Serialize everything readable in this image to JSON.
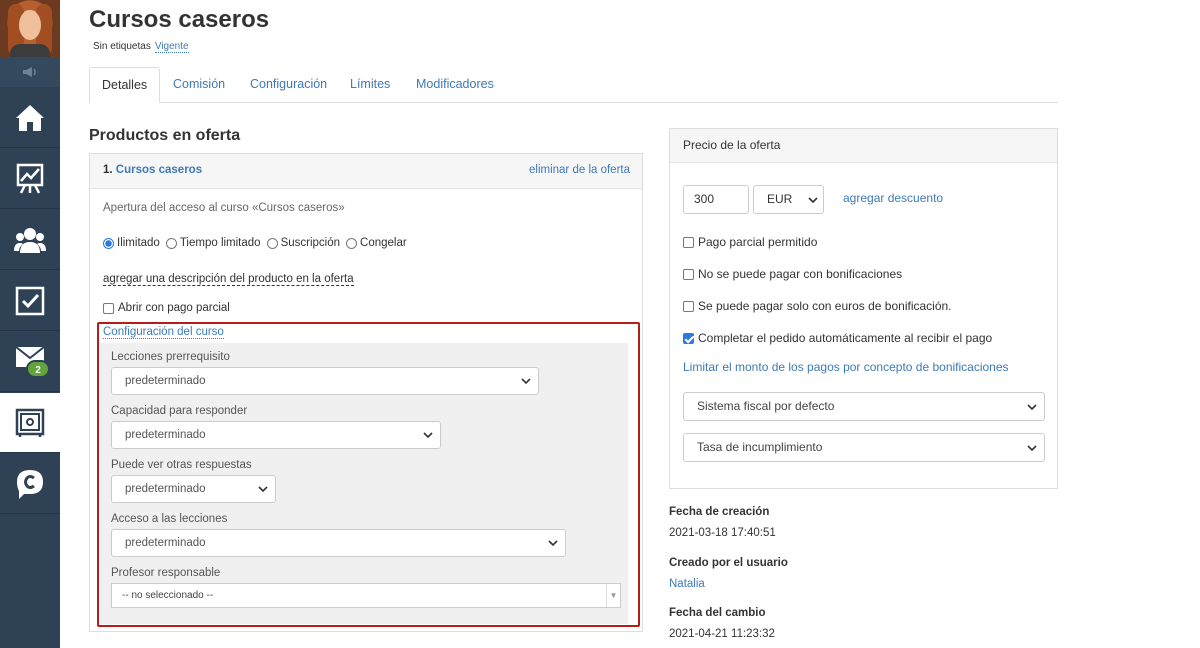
{
  "sidebar": {
    "items": [
      {
        "name": "home-icon"
      },
      {
        "name": "analytics-icon"
      },
      {
        "name": "users-icon"
      },
      {
        "name": "tasks-icon"
      },
      {
        "name": "mail-icon",
        "badge": "2"
      },
      {
        "name": "safe-icon"
      },
      {
        "name": "chat-icon"
      }
    ]
  },
  "header": {
    "title": "Cursos caseros",
    "tags": "Sin etiquetas",
    "status": "Vigente"
  },
  "tabs": [
    "Detalles",
    "Comisión",
    "Configuración",
    "Límites",
    "Modificadores"
  ],
  "products": {
    "heading": "Productos en oferta",
    "offer": {
      "number": "1.",
      "name": "Cursos caseros",
      "delete_label": "eliminar de la oferta",
      "description": "Apertura del acceso al curso «Cursos caseros»",
      "radio_options": [
        "Ilimitado",
        "Tiempo limitado",
        "Suscripción",
        "Congelar"
      ],
      "selected_radio": "Ilimitado",
      "add_description": "agregar una descripción del producto en la oferta",
      "partial_payment_label": "Abrir con pago parcial",
      "course_config_link": "Configuración del curso",
      "config": {
        "prereq_label": "Lecciones prerrequisito",
        "prereq_value": "predeterminado",
        "answer_label": "Capacidad para responder",
        "answer_value": "predeterminado",
        "others_label": "Puede ver otras respuestas",
        "others_value": "predeterminado",
        "access_label": "Acceso a las lecciones",
        "access_value": "predeterminado",
        "teacher_label": "Profesor responsable",
        "teacher_value": "-- no seleccionado --"
      }
    }
  },
  "price": {
    "heading": "Precio de la oferta",
    "amount": "300",
    "currency": "EUR",
    "add_discount": "agregar descuento",
    "checkboxes": [
      {
        "label": "Pago parcial permitido",
        "checked": false
      },
      {
        "label": "No se puede pagar con bonificaciones",
        "checked": false
      },
      {
        "label": "Se puede pagar solo con euros de bonificación.",
        "checked": false
      },
      {
        "label": "Completar el pedido automáticamente al recibir el pago",
        "checked": true
      }
    ],
    "limit_link": "Limitar el monto de los pagos por concepto de bonificaciones",
    "tax_system": "Sistema fiscal por defecto",
    "default_rate": "Tasa de incumplimiento"
  },
  "meta": {
    "created_label": "Fecha de creación",
    "created_value": "2021-03-18 17:40:51",
    "creator_label": "Creado por el usuario",
    "creator_value": "Natalia",
    "changed_label": "Fecha del cambio",
    "changed_value": "2021-04-21 11:23:32"
  }
}
